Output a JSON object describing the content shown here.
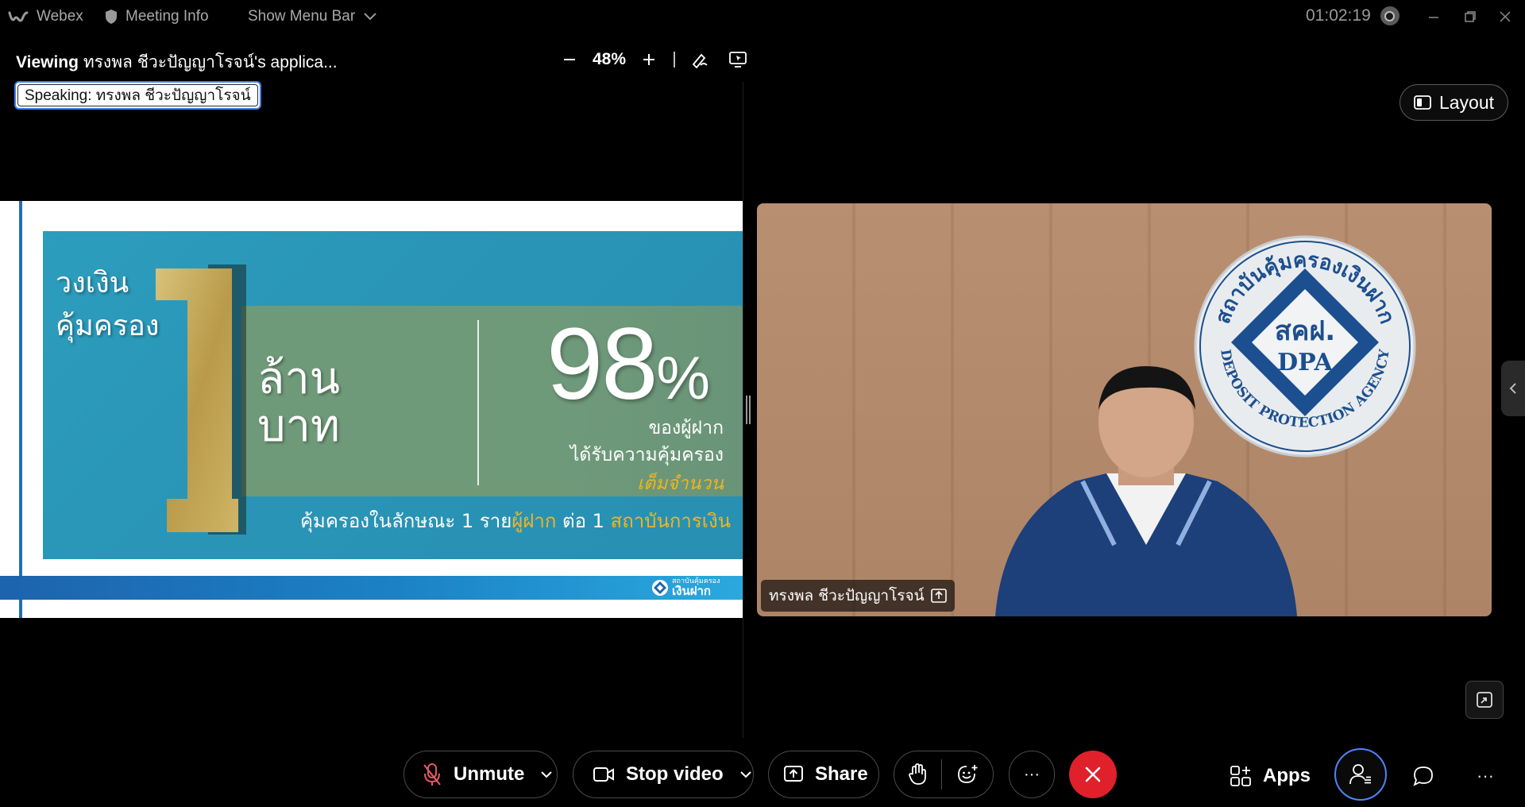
{
  "titlebar": {
    "app_name": "Webex",
    "meeting_info": "Meeting Info",
    "show_menu_bar": "Show Menu Bar",
    "timer": "01:02:19"
  },
  "share_view": {
    "viewing_prefix": "Viewing",
    "viewing_name": "ทรงพล ชีวะปัญญาโรจน์'s applica...",
    "zoom": "48%",
    "speaking": "Speaking: ทรงพล ชีวะปัญญาโรจน์"
  },
  "slide": {
    "line1": "วงเงิน",
    "line2": "คุ้มครอง",
    "big_number": "1",
    "unit1": "ล้าน",
    "unit2": "บาท",
    "percent_value": "98",
    "percent_sign": "%",
    "desc1": "ของผู้ฝาก",
    "desc2": "ได้รับความคุ้มครอง",
    "desc3": "เต็มจำนวน",
    "foot_a": "คุ้มครองในลักษณะ 1 ราย",
    "foot_b": "ผู้ฝาก",
    "foot_c": " ต่อ 1 ",
    "foot_d": "สถาบันการเงิน",
    "logo_top": "สถาบันคุ้มครอง",
    "logo_bottom": "เงินฝาก"
  },
  "video": {
    "participant_name": "ทรงพล ชีวะปัญญาโรจน์",
    "emblem_thai_top": "สถาบันคุ้มครองเงินฝาก",
    "emblem_short": "สคฝ.",
    "emblem_dpa": "DPA",
    "emblem_english": "DEPOSIT PROTECTION AGENCY"
  },
  "controls": {
    "layout": "Layout",
    "unmute": "Unmute",
    "stop_video": "Stop video",
    "share": "Share",
    "apps": "Apps",
    "more": "···"
  },
  "colors": {
    "end_call": "#e0202b",
    "accent_blue": "#4f84f7",
    "gold": "#f0b51f"
  }
}
